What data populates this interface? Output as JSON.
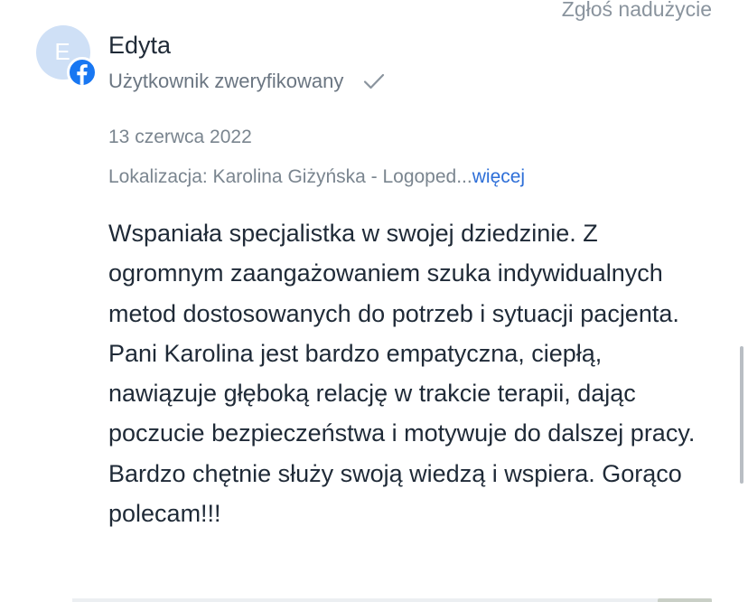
{
  "header": {
    "report_label": "Zgłoś nadużycie"
  },
  "review": {
    "avatar_initial": "E",
    "author_name": "Edyta",
    "verified_label": "Użytkownik zweryfikowany",
    "date": "13 czerwca 2022",
    "location_text": "Lokalizacja: Karolina Giżyńska - Logoped...",
    "more_label": "więcej",
    "body": "Wspaniała specjalistka w swojej dziedzinie. Z ogromnym zaangażowaniem szuka indywidualnych metod dostosowanych do potrzeb i sytuacji pacjenta. Pani Karolina jest bardzo empatyczna, ciepłą, nawiązuje głęboką relację w trakcie terapii, dając poczucie bezpieczeństwa i motywuje do dalszej pracy. Bardzo chętnie służy swoją wiedzą i wspiera. Gorąco polecam!!!"
  },
  "icons": {
    "source_badge": "facebook-icon",
    "verified": "check-icon"
  },
  "colors": {
    "avatar_bg": "#cfe0f6",
    "facebook_blue": "#1877f2",
    "link_blue": "#2e6fd8",
    "muted_text": "#7a858f"
  }
}
